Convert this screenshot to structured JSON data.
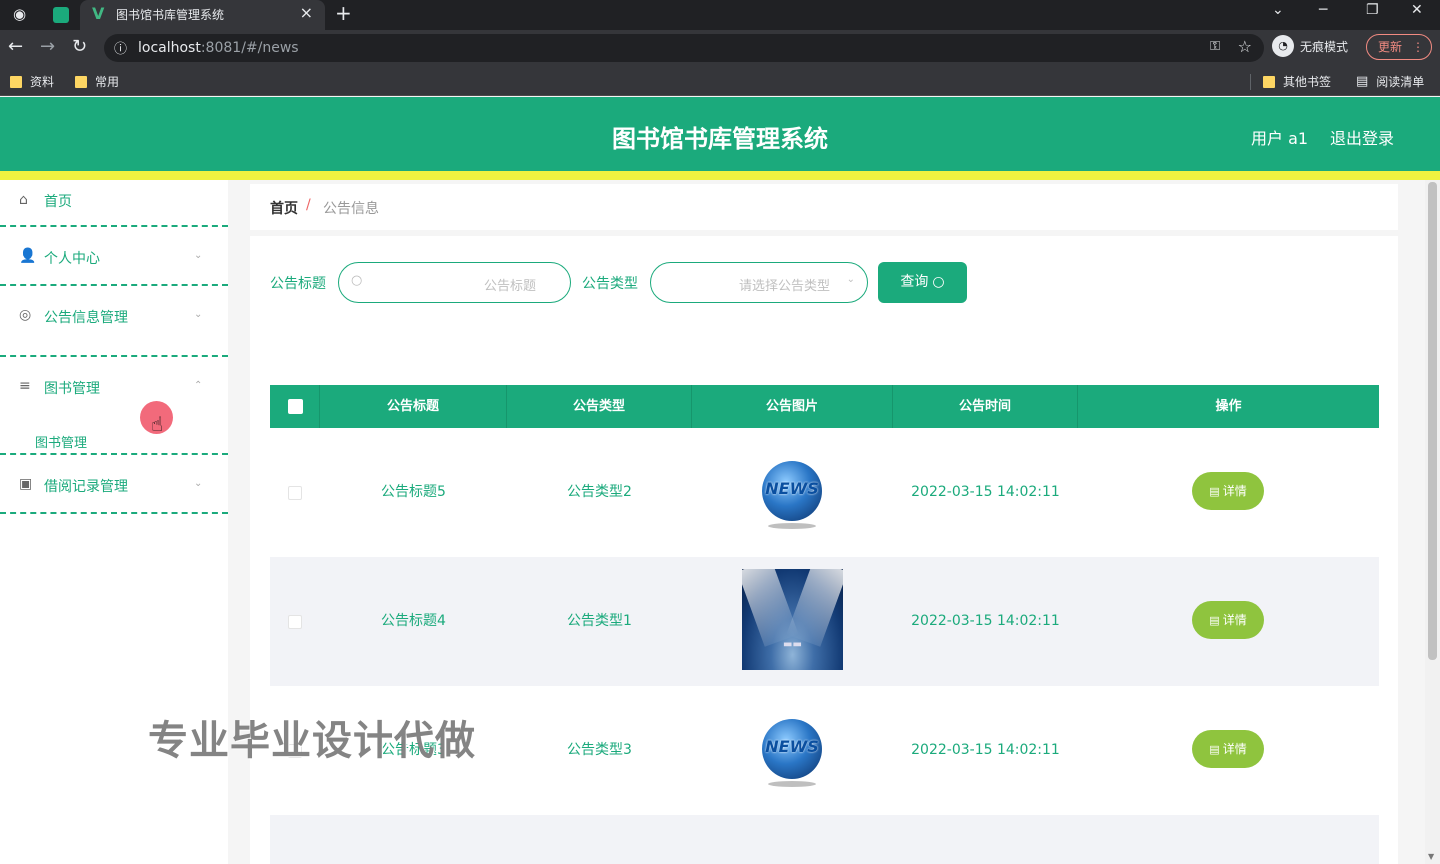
{
  "browser": {
    "tab_title": "图书馆书库管理系统",
    "url_host": "localhost",
    "url_rest": ":8081/#/news",
    "incognito_label": "无痕模式",
    "update_label": "更新",
    "bookmarks": [
      "资料",
      "常用"
    ],
    "other_bookmarks": "其他书签",
    "reading_list": "阅读清单"
  },
  "header": {
    "title": "图书馆书库管理系统",
    "user": "用户 a1",
    "logout": "退出登录"
  },
  "sidebar": {
    "items": [
      {
        "label": "首页",
        "icon": "home-icon"
      },
      {
        "label": "个人中心",
        "icon": "user-icon"
      },
      {
        "label": "公告信息管理",
        "icon": "compass-icon"
      },
      {
        "label": "图书管理",
        "icon": "list-icon"
      },
      {
        "label": "借阅记录管理",
        "icon": "clipboard-icon"
      }
    ],
    "submenu_label": "图书管理"
  },
  "breadcrumb": {
    "home": "首页",
    "separator": "/",
    "current": "公告信息"
  },
  "filters": {
    "title_label": "公告标题",
    "title_placeholder": "公告标题",
    "type_label": "公告类型",
    "type_placeholder": "请选择公告类型",
    "query_label": "查询"
  },
  "table": {
    "columns": [
      "公告标题",
      "公告类型",
      "公告图片",
      "公告时间",
      "操作"
    ],
    "rows": [
      {
        "title": "公告标题5",
        "type": "公告类型2",
        "image": "news-globe",
        "time": "2022-03-15 14:02:11",
        "action": "详情"
      },
      {
        "title": "公告标题4",
        "type": "公告类型1",
        "image": "spotlight-stage",
        "time": "2022-03-15 14:02:11",
        "action": "详情"
      },
      {
        "title": "公告标题3",
        "type": "公告类型3",
        "image": "news-globe",
        "time": "2022-03-15 14:02:11",
        "action": "详情"
      }
    ]
  },
  "watermark": "专业毕业设计代做",
  "colors": {
    "primary": "#1baa7c",
    "accent_bar": "#f0f240",
    "detail_button": "#8fc43e"
  }
}
